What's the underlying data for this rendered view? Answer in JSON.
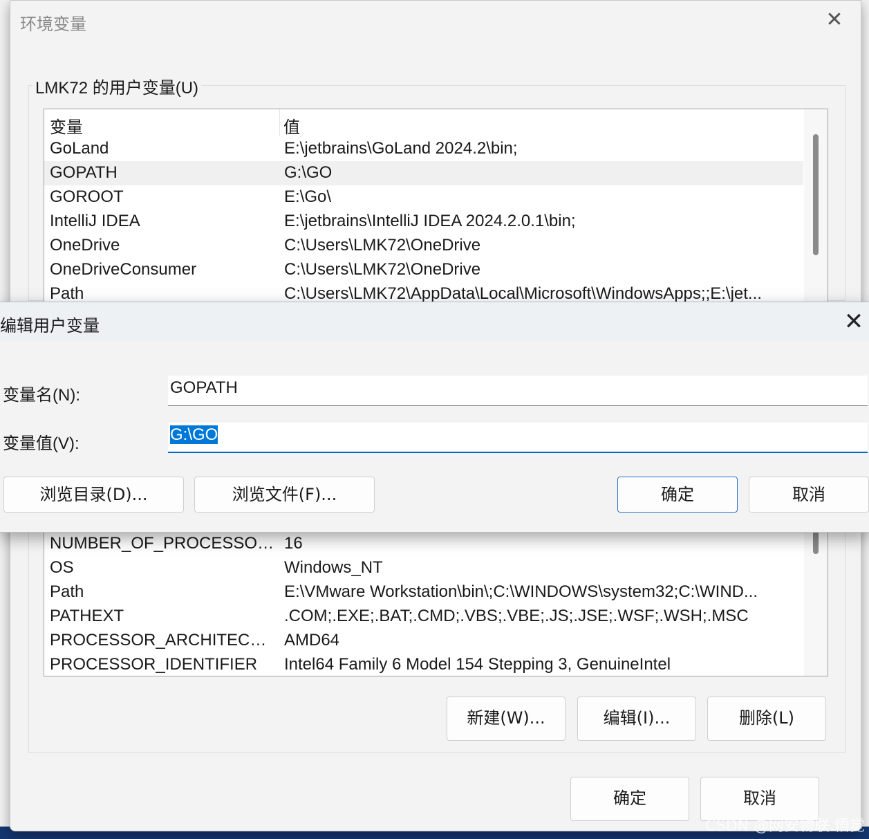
{
  "env_dialog": {
    "title": "环境变量",
    "close_glyph": "✕",
    "user_group_label": "LMK72 的用户变量(U)",
    "columns": [
      "变量",
      "值"
    ],
    "user_rows": [
      {
        "name": "GoLand",
        "value": "E:\\jetbrains\\GoLand 2024.2\\bin;"
      },
      {
        "name": "GOPATH",
        "value": "G:\\GO"
      },
      {
        "name": "GOROOT",
        "value": "E:\\Go\\"
      },
      {
        "name": "IntelliJ IDEA",
        "value": "E:\\jetbrains\\IntelliJ IDEA 2024.2.0.1\\bin;"
      },
      {
        "name": "OneDrive",
        "value": "C:\\Users\\LMK72\\OneDrive"
      },
      {
        "name": "OneDriveConsumer",
        "value": "C:\\Users\\LMK72\\OneDrive"
      },
      {
        "name": "Path",
        "value": "C:\\Users\\LMK72\\AppData\\Local\\Microsoft\\WindowsApps;;E:\\jet..."
      }
    ],
    "system_rows": [
      {
        "name": "NUMBER_OF_PROCESSORS",
        "value": "16"
      },
      {
        "name": "OS",
        "value": "Windows_NT"
      },
      {
        "name": "Path",
        "value": "E:\\VMware Workstation\\bin\\;C:\\WINDOWS\\system32;C:\\WIND..."
      },
      {
        "name": "PATHEXT",
        "value": ".COM;.EXE;.BAT;.CMD;.VBS;.VBE;.JS;.JSE;.WSF;.WSH;.MSC"
      },
      {
        "name": "PROCESSOR_ARCHITECTU...",
        "value": "AMD64"
      },
      {
        "name": "PROCESSOR_IDENTIFIER",
        "value": "Intel64 Family 6 Model 154 Stepping 3, GenuineIntel"
      }
    ],
    "system_buttons": {
      "new": "新建(W)...",
      "edit": "编辑(I)...",
      "delete": "删除(L)"
    },
    "ok": "确定",
    "cancel": "取消"
  },
  "edit_dialog": {
    "title": "编辑用户变量",
    "close_glyph": "✕",
    "name_label": "变量名(N):",
    "name_value": "GOPATH",
    "value_label": "变量值(V):",
    "value_value": "G:\\GO",
    "browse_dir": "浏览目录(D)...",
    "browse_file": "浏览文件(F)...",
    "ok": "确定",
    "cancel": "取消"
  },
  "watermark": "CSDN @网安物联.悟觉"
}
